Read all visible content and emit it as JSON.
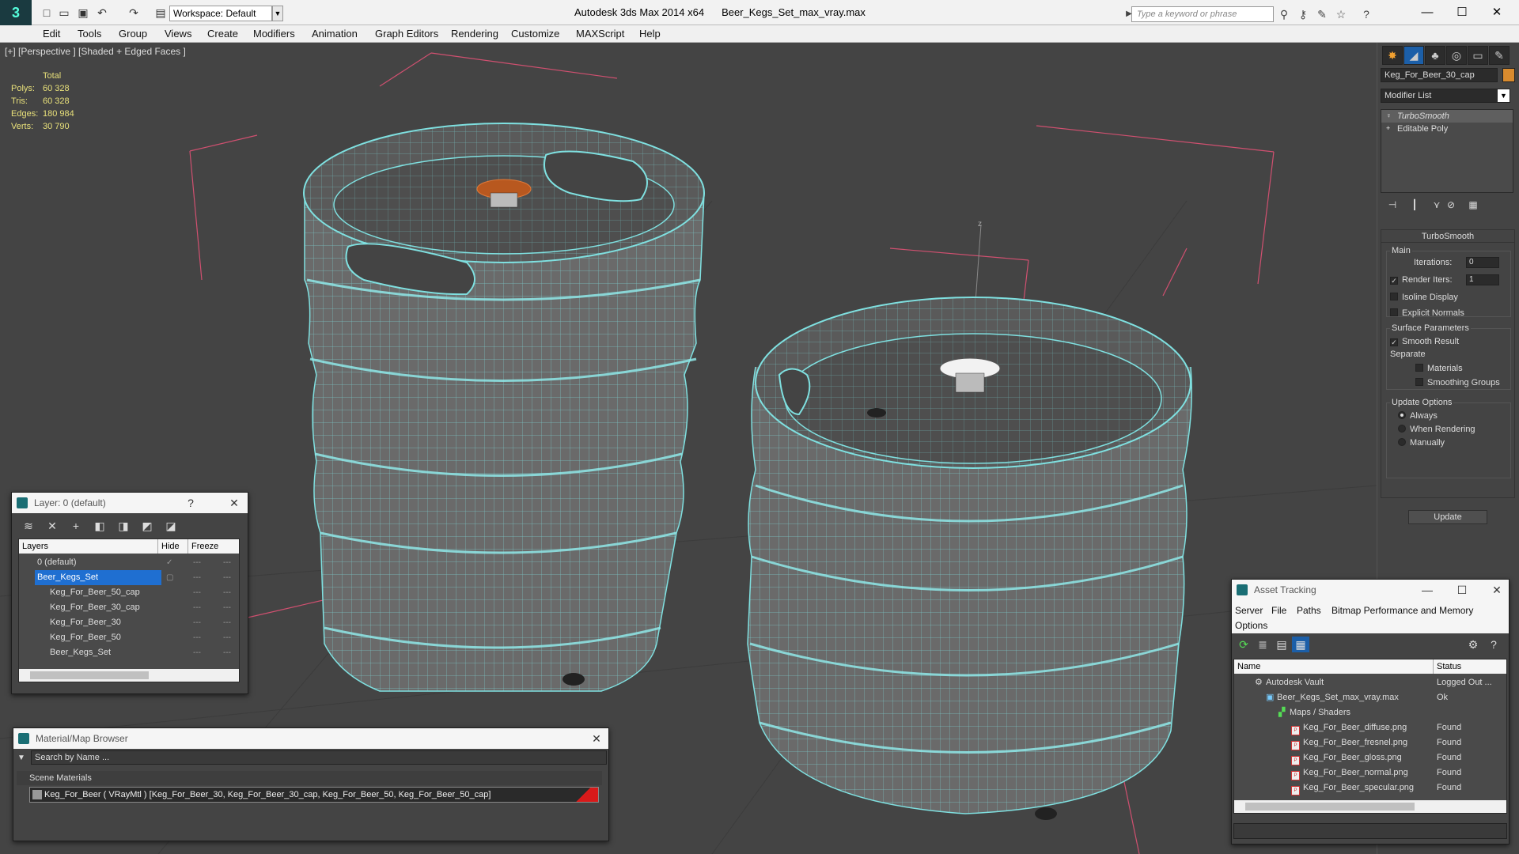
{
  "app": {
    "title": "Autodesk 3ds Max  2014 x64",
    "file": "Beer_Kegs_Set_max_vray.max",
    "workspace": "Workspace: Default",
    "search_placeholder": "Type a keyword or phrase"
  },
  "menu": [
    "Edit",
    "Tools",
    "Group",
    "Views",
    "Create",
    "Modifiers",
    "Animation",
    "Graph Editors",
    "Rendering",
    "Customize",
    "MAXScript",
    "Help"
  ],
  "viewport": {
    "label": "[+] [Perspective ] [Shaded + Edged Faces ]",
    "stats": {
      "header": "Total",
      "rows": [
        {
          "label": "Polys:",
          "value": "60 328"
        },
        {
          "label": "Tris:",
          "value": "60 328"
        },
        {
          "label": "Edges:",
          "value": "180 984"
        },
        {
          "label": "Verts:",
          "value": "30 790"
        }
      ]
    },
    "axis_label": "z"
  },
  "command_panel": {
    "object_name": "Keg_For_Beer_30_cap",
    "object_color": "#d98b2e",
    "modifier_list": "Modifier List",
    "stack": [
      {
        "name": "TurboSmooth",
        "icon": "lightbulb-icon",
        "selected": true
      },
      {
        "name": "Editable Poly",
        "icon": "plus-icon",
        "selected": false
      }
    ],
    "turbosmooth": {
      "title": "TurboSmooth",
      "main_label": "Main",
      "iterations_label": "Iterations:",
      "iterations_value": "0",
      "render_iters_label": "Render Iters:",
      "render_iters_value": "1",
      "render_iters_checked": true,
      "isoline_label": "Isoline Display",
      "explicit_normals_label": "Explicit Normals",
      "surface_params_label": "Surface Parameters",
      "smooth_result_label": "Smooth Result",
      "separate_label": "Separate",
      "materials_label": "Materials",
      "smoothing_groups_label": "Smoothing Groups",
      "update_options_label": "Update Options",
      "always_label": "Always",
      "when_rendering_label": "When Rendering",
      "manually_label": "Manually",
      "update_button": "Update"
    }
  },
  "layer_panel": {
    "title": "Layer: 0 (default)",
    "help": "?",
    "columns": [
      "Layers",
      "Hide",
      "Freeze"
    ],
    "rows": [
      {
        "name": "0 (default)",
        "indent": 1,
        "selected": false
      },
      {
        "name": "Beer_Kegs_Set",
        "indent": 1,
        "selected": true
      },
      {
        "name": "Keg_For_Beer_50_cap",
        "indent": 2,
        "selected": false
      },
      {
        "name": "Keg_For_Beer_30_cap",
        "indent": 2,
        "selected": false
      },
      {
        "name": "Keg_For_Beer_30",
        "indent": 2,
        "selected": false
      },
      {
        "name": "Keg_For_Beer_50",
        "indent": 2,
        "selected": false
      },
      {
        "name": "Beer_Kegs_Set",
        "indent": 2,
        "selected": false
      }
    ]
  },
  "material_browser": {
    "title": "Material/Map Browser",
    "search_placeholder": "Search by Name ...",
    "group": "Scene Materials",
    "item": "Keg_For_Beer  ( VRayMtl ) [Keg_For_Beer_30, Keg_For_Beer_30_cap, Keg_For_Beer_50, Keg_For_Beer_50_cap]"
  },
  "asset_tracking": {
    "title": "Asset Tracking",
    "menu": [
      "Server",
      "File",
      "Paths",
      "Bitmap Performance and Memory",
      "Options"
    ],
    "columns": [
      "Name",
      "Status"
    ],
    "rows": [
      {
        "name": "Autodesk Vault",
        "status": "Logged Out ...",
        "indent": 1,
        "icon": "vault-icon"
      },
      {
        "name": "Beer_Kegs_Set_max_vray.max",
        "status": "Ok",
        "indent": 2,
        "icon": "max-file-icon"
      },
      {
        "name": "Maps / Shaders",
        "status": "",
        "indent": 3,
        "icon": "maps-icon"
      },
      {
        "name": "Keg_For_Beer_diffuse.png",
        "status": "Found",
        "indent": 4,
        "icon": "png-icon"
      },
      {
        "name": "Keg_For_Beer_fresnel.png",
        "status": "Found",
        "indent": 4,
        "icon": "png-icon"
      },
      {
        "name": "Keg_For_Beer_gloss.png",
        "status": "Found",
        "indent": 4,
        "icon": "png-icon"
      },
      {
        "name": "Keg_For_Beer_normal.png",
        "status": "Found",
        "indent": 4,
        "icon": "png-icon"
      },
      {
        "name": "Keg_For_Beer_specular.png",
        "status": "Found",
        "indent": 4,
        "icon": "png-icon"
      }
    ]
  }
}
